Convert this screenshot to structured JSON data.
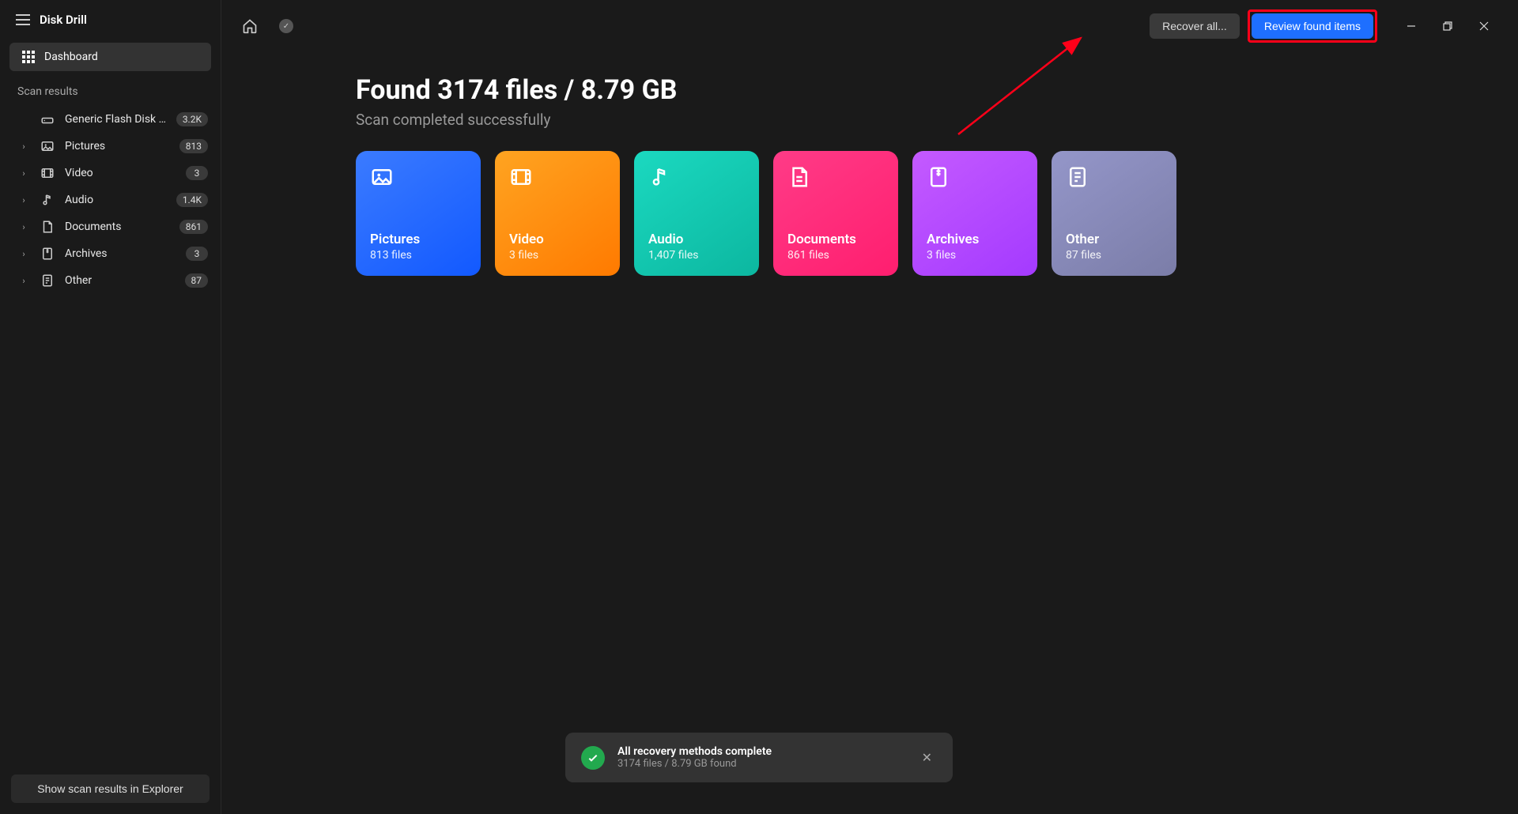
{
  "app_title": "Disk Drill",
  "nav": {
    "dashboard_label": "Dashboard",
    "section_label": "Scan results"
  },
  "sidebar_items": [
    {
      "label": "Generic Flash Disk USB...",
      "badge": "3.2K",
      "icon": "disk",
      "chevron": ""
    },
    {
      "label": "Pictures",
      "badge": "813",
      "icon": "pictures",
      "chevron": "›"
    },
    {
      "label": "Video",
      "badge": "3",
      "icon": "video",
      "chevron": "›"
    },
    {
      "label": "Audio",
      "badge": "1.4K",
      "icon": "audio",
      "chevron": "›"
    },
    {
      "label": "Documents",
      "badge": "861",
      "icon": "documents",
      "chevron": "›"
    },
    {
      "label": "Archives",
      "badge": "3",
      "icon": "archives",
      "chevron": "›"
    },
    {
      "label": "Other",
      "badge": "87",
      "icon": "other",
      "chevron": "›"
    }
  ],
  "footer_button": "Show scan results in Explorer",
  "topbar": {
    "recover_all": "Recover all...",
    "review": "Review found items"
  },
  "headline": "Found 3174 files / 8.79 GB",
  "subhead": "Scan completed successfully",
  "cards": [
    {
      "title": "Pictures",
      "sub": "813 files",
      "class": "card-pictures"
    },
    {
      "title": "Video",
      "sub": "3 files",
      "class": "card-video"
    },
    {
      "title": "Audio",
      "sub": "1,407 files",
      "class": "card-audio"
    },
    {
      "title": "Documents",
      "sub": "861 files",
      "class": "card-documents"
    },
    {
      "title": "Archives",
      "sub": "3 files",
      "class": "card-archives"
    },
    {
      "title": "Other",
      "sub": "87 files",
      "class": "card-other"
    }
  ],
  "toast": {
    "title": "All recovery methods complete",
    "sub": "3174 files / 8.79 GB found"
  }
}
